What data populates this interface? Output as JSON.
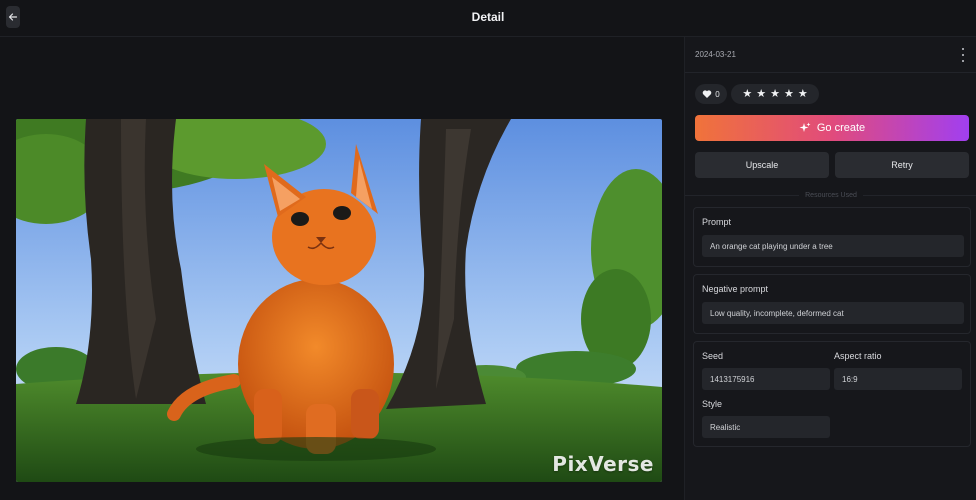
{
  "header": {
    "title": "Detail"
  },
  "meta": {
    "date": "2024-03-21"
  },
  "reactions": {
    "like_count": "0",
    "rating_stars": 5
  },
  "actions": {
    "go_create_label": "Go create",
    "upscale_label": "Upscale",
    "retry_label": "Retry"
  },
  "resources": {
    "section_label": "Resources Used"
  },
  "prompt": {
    "label": "Prompt",
    "value": "An orange cat playing under a tree"
  },
  "negative_prompt": {
    "label": "Negative prompt",
    "value": "Low quality, incomplete, deformed cat"
  },
  "params": {
    "seed_label": "Seed",
    "seed_value": "1413175916",
    "aspect_label": "Aspect ratio",
    "aspect_value": "16:9",
    "style_label": "Style",
    "style_value": "Realistic"
  },
  "image": {
    "watermark": "PixVerse"
  },
  "colors": {
    "background": "#131417",
    "panel": "#16171b",
    "field": "#24262b",
    "gradient_start": "#f0733a",
    "gradient_mid": "#e14b7c",
    "gradient_end": "#a13ff0"
  },
  "icons": {
    "back": "arrow-left",
    "more": "vertical-dots",
    "like": "heart",
    "star": "star",
    "sparkle": "sparkle"
  }
}
